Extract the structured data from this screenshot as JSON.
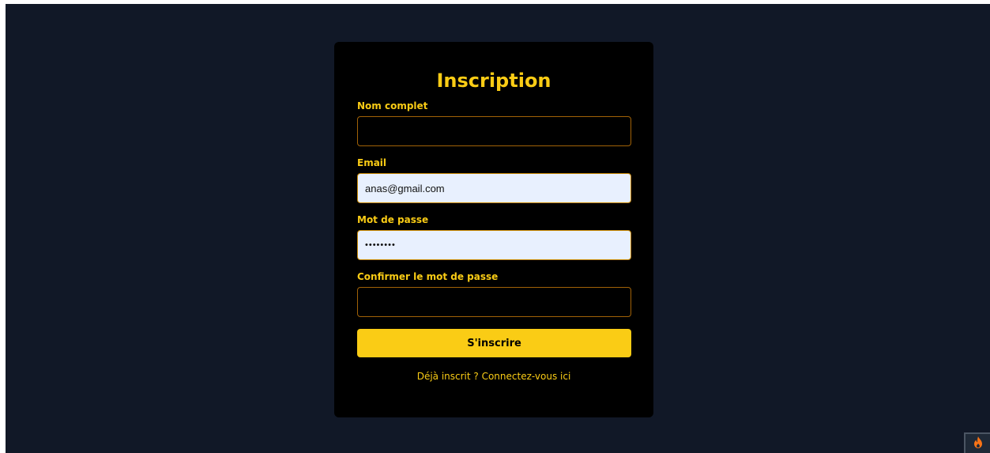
{
  "form": {
    "title": "Inscription",
    "fields": {
      "full_name": {
        "label": "Nom complet",
        "value": ""
      },
      "email": {
        "label": "Email",
        "value": "anas@gmail.com"
      },
      "password": {
        "label": "Mot de passe",
        "value": "anas1234"
      },
      "confirm_password": {
        "label": "Confirmer le mot de passe",
        "value": ""
      }
    },
    "submit_label": "S'inscrire",
    "login_link": "Déjà inscrit ? Connectez-vous ici"
  },
  "corner_widget": {
    "icon": "flame-icon"
  },
  "colors": {
    "page_background": "#111827",
    "card_background": "#000000",
    "accent": "#facc15",
    "autofill_background": "#e8f0fe",
    "flame": "#f97316"
  }
}
